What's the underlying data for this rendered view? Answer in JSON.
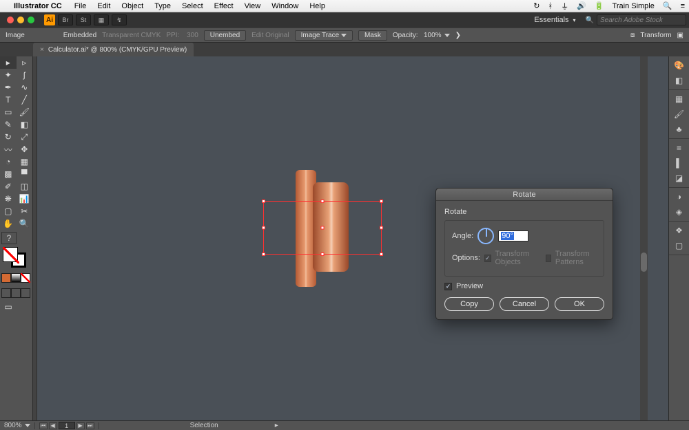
{
  "menubar": {
    "app_name": "Illustrator CC",
    "items": [
      "File",
      "Edit",
      "Object",
      "Type",
      "Select",
      "Effect",
      "View",
      "Window",
      "Help"
    ],
    "right_label": "Train Simple"
  },
  "header": {
    "bridge_label": "Br",
    "stock_label": "St",
    "workspace": "Essentials",
    "stock_placeholder": "Search Adobe Stock"
  },
  "controlbar": {
    "label_image": "Image",
    "embedded": "Embedded",
    "colorspace": "Transparent CMYK",
    "ppi_label": "PPI:",
    "ppi_value": "300",
    "btn_unembed": "Unembed",
    "btn_editoriginal": "Edit Original",
    "btn_imagetrace": "Image Trace",
    "btn_mask": "Mask",
    "opacity_label": "Opacity:",
    "opacity_value": "100%",
    "transform_label": "Transform"
  },
  "tab": {
    "title": "Calculator.ai* @ 800% (CMYK/GPU Preview)"
  },
  "dialog": {
    "title": "Rotate",
    "section_label": "Rotate",
    "angle_label": "Angle:",
    "angle_value": "90°",
    "options_label": "Options:",
    "transform_objects": "Transform Objects",
    "transform_patterns": "Transform Patterns",
    "preview_label": "Preview",
    "btn_copy": "Copy",
    "btn_cancel": "Cancel",
    "btn_ok": "OK"
  },
  "status": {
    "zoom": "800%",
    "page": "1",
    "mode": "Selection"
  },
  "colors": {
    "accent": "#ff9a00",
    "selection": "#ff3030"
  }
}
